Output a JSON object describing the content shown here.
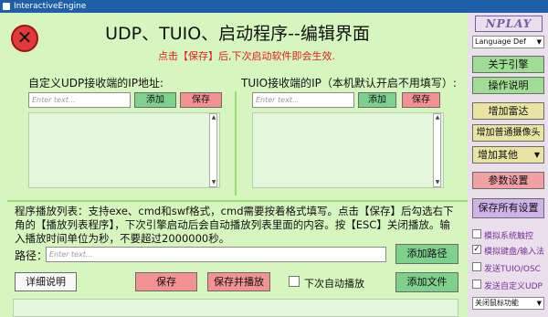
{
  "window": {
    "title": "InteractiveEngine"
  },
  "header": {
    "title": "UDP、TUIO、启动程序--编辑界面",
    "notice": "点击【保存】后,下次启动软件即会生效."
  },
  "udp": {
    "label": "自定义UDP接收端的IP地址:",
    "placeholder": "Enter text...",
    "add_label": "添加",
    "save_label": "保存"
  },
  "tuio": {
    "label": "TUIO接收端的IP（本机默认开启不用填写）:",
    "placeholder": "Enter text...",
    "add_label": "添加",
    "save_label": "保存"
  },
  "playlist": {
    "description": "程序播放列表：支持exe、cmd和swf格式，cmd需要按着格式填写。点击【保存】后勾选右下角的【播放列表程序】，下次引擎启动后会自动播放列表里面的内容。按【ESC】关闭播放。输入播放时间单位为秒，不要超过2000000秒。",
    "path_label": "路径：",
    "path_placeholder": "Enter text...",
    "add_path_label": "添加路径",
    "detail_label": "详细说明",
    "save_label": "保存",
    "save_play_label": "保存并播放",
    "autoplay_label": "下次自动播放",
    "add_file_label": "添加文件"
  },
  "sidebar": {
    "logo": "NPLAY",
    "language": "Language Def",
    "about_label": "关于引擎",
    "manual_label": "操作说明",
    "add_radar_label": "增加雷达",
    "add_camera_label": "增加普通摄像头",
    "add_other": "增加其他",
    "params_label": "参数设置",
    "save_all_label": "保存所有设置",
    "options": [
      {
        "label": "模拟系统触控",
        "checked": false
      },
      {
        "label": "模拟键盘/输入法",
        "checked": true
      },
      {
        "label": "发送TUIO/OSC",
        "checked": false
      },
      {
        "label": "发送自定义UDP",
        "checked": false
      }
    ],
    "mouse_func": "关闭鼠标功能"
  },
  "colors": {
    "main_bg": "#d6f5bf",
    "sidebar_bg": "#e9e0ec",
    "titlebar": "#1f5fa8",
    "accent_red": "#e21d1d",
    "btn_green": "#7ed18d",
    "btn_pink": "#f39193"
  }
}
